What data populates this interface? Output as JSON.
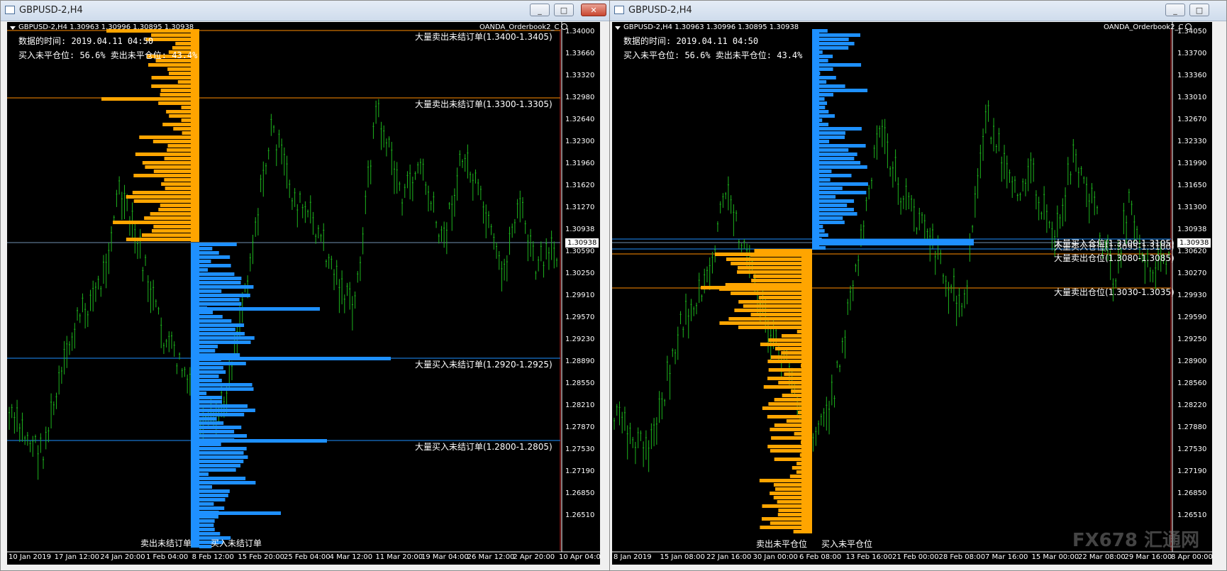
{
  "colors": {
    "candle": "#1db31d",
    "sell": "#ffa500",
    "buy": "#1e90ff",
    "bg": "#000000",
    "sell_line": "#ff8c00",
    "buy_line": "#1e90ff",
    "price_line": "#6f8fb0"
  },
  "left": {
    "window_title": "GBPUSD-2,H4",
    "header": "GBPUSD-2,H4  1.30963 1.30996 1.30895 1.30938",
    "indicator": "OANDA_Orderbook2_C",
    "info_time": "数据的时间: 2019.04.11 04:50",
    "info_pct": "买入未平仓位: 56.6%  卖出未平仓位: 43.4%",
    "price_scale": [
      "1.34000",
      "1.33660",
      "1.33320",
      "1.32980",
      "1.32640",
      "1.32300",
      "1.31960",
      "1.31620",
      "1.31270",
      "1.30938",
      "1.30590",
      "1.30250",
      "1.29910",
      "1.29570",
      "1.29230",
      "1.28890",
      "1.28550",
      "1.28210",
      "1.27870",
      "1.27530",
      "1.27190",
      "1.26850",
      "1.26510"
    ],
    "current_price": "1.30938",
    "annotations": [
      "大量卖出未结订单(1.3400-1.3405)",
      "大量卖出未结订单(1.3300-1.3305)",
      "大量买入未结订单(1.2920-1.2925)",
      "大量买入未结订单(1.2800-1.2805)"
    ],
    "bottom_sell": "卖出未结订单",
    "bottom_buy": "买入未结订单",
    "time_axis": [
      "10 Jan 2019",
      "17 Jan 12:00",
      "24 Jan 20:00",
      "1 Feb 04:00",
      "8 Feb 12:00",
      "15 Feb 20:00",
      "25 Feb 04:00",
      "4 Mar 12:00",
      "11 Mar 20:00",
      "19 Mar 04:00",
      "26 Mar 12:00",
      "2 Apr 20:00",
      "10 Apr 04:00"
    ]
  },
  "right": {
    "window_title": "GBPUSD-2,H4",
    "header": "GBPUSD-2,H4  1.30963 1.30996 1.30895 1.30938",
    "indicator": "OANDA_Orderbook2_C",
    "info_time": "数据的时间: 2019.04.11 04:50",
    "info_pct": "买入未平仓位: 56.6%  卖出未平仓位: 43.4%",
    "price_scale": [
      "1.34050",
      "1.33700",
      "1.33360",
      "1.33010",
      "1.32670",
      "1.32330",
      "1.31990",
      "1.31650",
      "1.31300",
      "1.30938",
      "1.30620",
      "1.30270",
      "1.29930",
      "1.29590",
      "1.29250",
      "1.28900",
      "1.28560",
      "1.28220",
      "1.27880",
      "1.27530",
      "1.27190",
      "1.26850",
      "1.26510"
    ],
    "current_price": "1.30938",
    "annotations": [
      "大量买入仓位(1.3100-1.3105)",
      "大量卖出仓位(1.3080-1.3085)",
      "大量卖出仓位(1.3030-1.3035)"
    ],
    "annotations_overlap": "大量买入仓位(1.3095-1.3100)",
    "bottom_sell": "卖出未平仓位",
    "bottom_buy": "买入未平仓位",
    "time_axis": [
      "8 Jan 2019",
      "15 Jan 08:00",
      "22 Jan 16:00",
      "30 Jan 00:00",
      "6 Feb 08:00",
      "13 Feb 16:00",
      "21 Feb 00:00",
      "28 Feb 08:00",
      "7 Mar 16:00",
      "15 Mar 00:00",
      "22 Mar 08:00",
      "29 Mar 16:00",
      "8 Apr 00:00"
    ],
    "watermark": "FX678 汇通网"
  }
}
